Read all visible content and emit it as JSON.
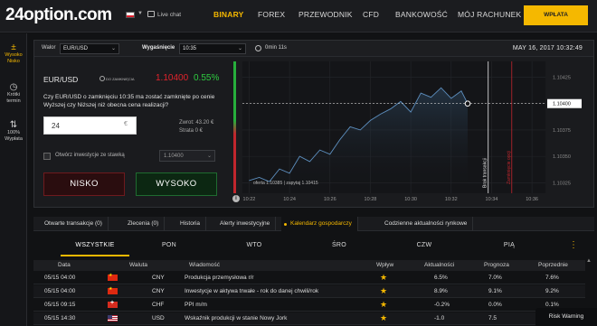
{
  "header": {
    "logo": "24option.com",
    "live_chat": "Live chat",
    "nav": [
      "BINARY",
      "FOREX",
      "PRZEWODNIK",
      "CFD",
      "BANKOWOŚĆ",
      "MÓJ RACHUNEK"
    ],
    "deposit": "WPŁATA"
  },
  "sidebar": {
    "items": [
      {
        "icon": "plus-minus-icon",
        "label1": "Wysoko",
        "label2": "Nisko"
      },
      {
        "icon": "clock-icon",
        "label1": "Krótki",
        "label2": "termin"
      },
      {
        "icon": "double-arrow-icon",
        "label1": "100%",
        "label2": "Wypłata"
      }
    ]
  },
  "trade": {
    "asset_label": "Walor",
    "asset_value": "EUR/USD",
    "expiry_label": "Wygaśnięcie",
    "expiry_value": "10:35",
    "timer": "0min  11s",
    "date": "MAY 16, 2017 10:32:49",
    "asset": "EUR/USD",
    "status": "DO ZAMKNIĘCIA",
    "price": "1.10400",
    "change": "0.55%",
    "question": "Czy EUR/USD o zamknięciu 10:35 ma zostać zamknięte po cenie Wyższej czy Niższej niż obecna cena realizacji?",
    "stake": "24",
    "currency": "€",
    "return_label": "Zwrot: 43.20 €",
    "loss_label": "Strata 0 €",
    "checkbox_label": "Otwórz inwestycje ze stawką",
    "stake_select": "1.10400",
    "low": "NISKO",
    "high": "WYSOKO"
  },
  "chart_data": {
    "type": "line",
    "x_ticks": [
      "10:22",
      "10:24",
      "10:26",
      "10:28",
      "10:30",
      "10:32",
      "10:34",
      "10:36"
    ],
    "y_ticks": [
      "1.10425",
      "1.10400",
      "1.10375",
      "1.10350",
      "1.10325"
    ],
    "current_price": "1.10400",
    "annotation": "oferta 1.10385 | zapytaj 1.10415",
    "marker_trade": "Brak transakcji",
    "marker_expiry": "Zamknięcie opcji",
    "series": [
      {
        "x": [
          "10:22:00",
          "10:22:30",
          "10:23:00",
          "10:23:30",
          "10:24:00",
          "10:24:30",
          "10:25:00",
          "10:25:30",
          "10:26:00",
          "10:26:30",
          "10:27:00",
          "10:27:30",
          "10:28:00",
          "10:28:30",
          "10:29:00",
          "10:29:30",
          "10:30:00",
          "10:30:30",
          "10:31:00",
          "10:31:30",
          "10:32:00",
          "10:32:30",
          "10:32:49"
        ],
        "y": [
          1.10327,
          1.1033,
          1.10326,
          1.10338,
          1.10334,
          1.1035,
          1.10345,
          1.10356,
          1.10352,
          1.10366,
          1.10378,
          1.10375,
          1.10384,
          1.1039,
          1.10395,
          1.10402,
          1.10392,
          1.1041,
          1.10406,
          1.10415,
          1.10405,
          1.10412,
          1.104
        ]
      }
    ]
  },
  "tabs": [
    {
      "label": "Otwarte transakcje (0)"
    },
    {
      "label": "Zlecenia (0)"
    },
    {
      "label": "Historia"
    },
    {
      "label": "Alerty inwestycyjne"
    },
    {
      "label": "Kalendarz gospodarczy"
    },
    {
      "label": "Codzienne aktualności rynkowe"
    }
  ],
  "days": [
    "WSZYSTKIE",
    "PON",
    "WTO",
    "ŚRO",
    "CZW",
    "PIĄ"
  ],
  "table": {
    "headers": [
      "Data",
      "Waluta",
      "Wiadomość",
      "Wpływ",
      "Aktualności",
      "Prognoza",
      "Poprzednie"
    ],
    "rows": [
      {
        "date": "05/15 04:00",
        "flag": "cn",
        "currency": "CNY",
        "news": "Produkcja przemysłowa r/r",
        "actual": "6.5%",
        "forecast": "7.0%",
        "previous": "7.6%"
      },
      {
        "date": "05/15 04:00",
        "flag": "cn",
        "currency": "CNY",
        "news": "Inwestycje w aktywa trwałe - rok do danej chwili/rok",
        "actual": "8.9%",
        "forecast": "9.1%",
        "previous": "9.2%"
      },
      {
        "date": "05/15 09:15",
        "flag": "ch",
        "currency": "CHF",
        "news": "PPI m/m",
        "actual": "-0.2%",
        "forecast": "0.0%",
        "previous": "0.1%"
      },
      {
        "date": "05/15 14:30",
        "flag": "us",
        "currency": "USD",
        "news": "Wskaźnik produkcji w stanie Nowy Jork",
        "actual": "-1.0",
        "forecast": "7.5",
        "previous": ""
      }
    ]
  },
  "risk_warning": "Risk Warning"
}
